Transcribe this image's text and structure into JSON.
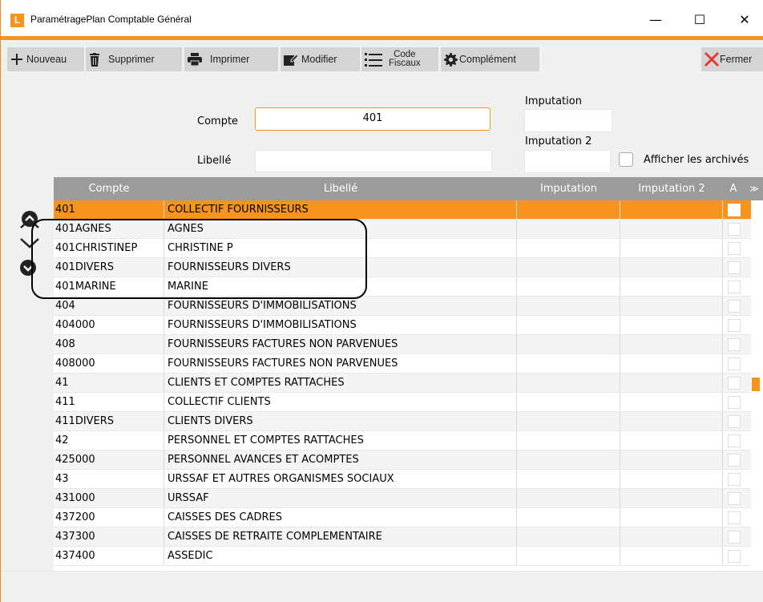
{
  "window": {
    "title": "ParamétragePlan Comptable Général",
    "app_icon_letter": "L",
    "minimize": "—",
    "maximize": "☐",
    "close": "✕"
  },
  "toolbar": {
    "new_label": "Nouveau",
    "delete_label": "Supprimer",
    "print_label": "Imprimer",
    "edit_label": "Modifier",
    "code_label_1": "Code",
    "code_label_2": "Fiscaux",
    "complement_label": "Complément",
    "close_label": "Fermer"
  },
  "filters": {
    "compte_label": "Compte",
    "compte_value": "401",
    "libelle_label": "Libellé",
    "libelle_value": "",
    "imputation_label": "Imputation",
    "imputation_value": "",
    "imputation2_label": "Imputation 2",
    "imputation2_value": "",
    "show_archived_label": "Afficher les archivés"
  },
  "grid": {
    "columns": [
      "Compte",
      "Libellé",
      "Imputation",
      "Imputation 2",
      "A"
    ],
    "rows": [
      {
        "compte": "401",
        "libelle": "COLLECTIF FOURNISSEURS"
      },
      {
        "compte": "401AGNES",
        "libelle": "AGNES"
      },
      {
        "compte": "401CHRISTINEP",
        "libelle": "CHRISTINE P"
      },
      {
        "compte": "401DIVERS",
        "libelle": "FOURNISSEURS DIVERS"
      },
      {
        "compte": "401MARINE",
        "libelle": "MARINE"
      },
      {
        "compte": "404",
        "libelle": "FOURNISSEURS D'IMMOBILISATIONS"
      },
      {
        "compte": "404000",
        "libelle": "FOURNISSEURS D'IMMOBILISATIONS"
      },
      {
        "compte": "408",
        "libelle": "FOURNISSEURS FACTURES NON PARVENUES"
      },
      {
        "compte": "408000",
        "libelle": "FOURNISSEURS FACTURES NON PARVENUES"
      },
      {
        "compte": "41",
        "libelle": "CLIENTS ET COMPTES RATTACHES"
      },
      {
        "compte": "411",
        "libelle": "COLLECTIF CLIENTS"
      },
      {
        "compte": "411DIVERS",
        "libelle": "CLIENTS DIVERS"
      },
      {
        "compte": "42",
        "libelle": "PERSONNEL ET COMPTES RATTACHES"
      },
      {
        "compte": "425000",
        "libelle": "PERSONNEL AVANCES ET ACOMPTES"
      },
      {
        "compte": "43",
        "libelle": "URSSAF ET AUTRES ORGANISMES SOCIAUX"
      },
      {
        "compte": "431000",
        "libelle": "URSSAF"
      },
      {
        "compte": "437200",
        "libelle": "CAISSES DES CADRES"
      },
      {
        "compte": "437300",
        "libelle": "CAISSES DE RETRAITE COMPLEMENTAIRE"
      },
      {
        "compte": "437400",
        "libelle": "ASSEDIC"
      }
    ],
    "selected_index": 0
  },
  "colors": {
    "accent": "#f7941d",
    "header": "#9b9b9b",
    "toolbar_button": "#d4d4d4",
    "close_icon": "#e8372c"
  }
}
